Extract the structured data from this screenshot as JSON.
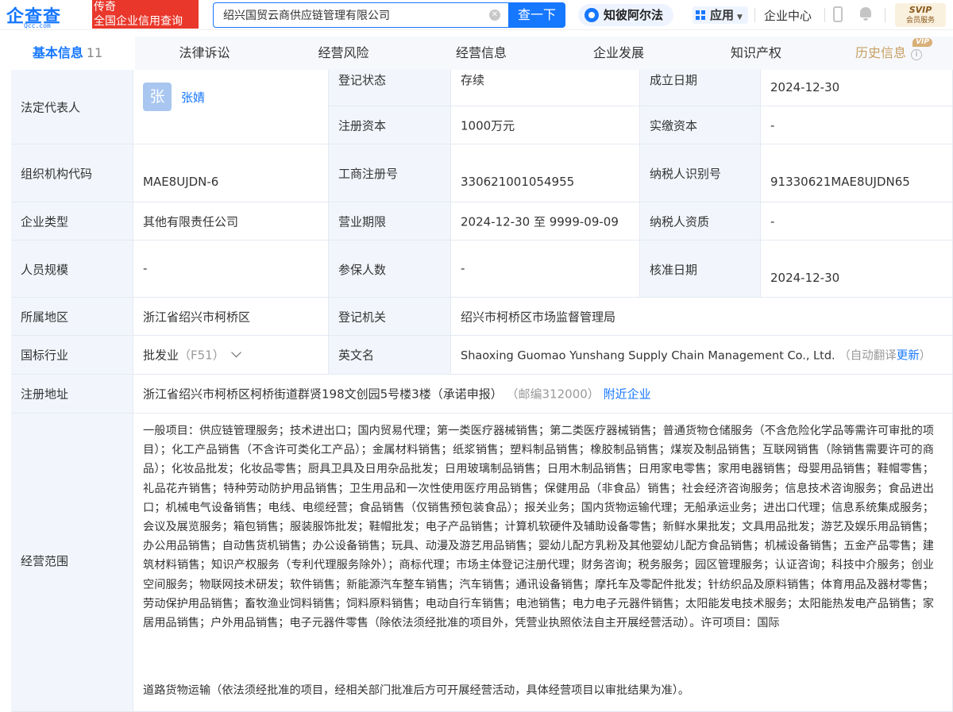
{
  "header": {
    "logo_text": "企查查",
    "logo_domain": "Qcc.com",
    "slogan_line1": "传奇",
    "slogan_line2": "全国企业信用查询",
    "search_value": "绍兴国贸云商供应链管理有限公司",
    "search_button": "查一下",
    "zhibi_label": "知彼阿尔法",
    "apps_label": "应用",
    "enterprise_center": "企业中心",
    "svip_title": "SVIP",
    "svip_sub": "会员服务",
    "accent_color": "#1677ff",
    "slogan_color": "#e9372b"
  },
  "tabs": [
    {
      "label": "基本信息",
      "count": "11"
    },
    {
      "label": "法律诉讼"
    },
    {
      "label": "经营风险"
    },
    {
      "label": "经营信息"
    },
    {
      "label": "企业发展"
    },
    {
      "label": "知识产权"
    },
    {
      "label": "历史信息",
      "badge": "VIP"
    }
  ],
  "info": {
    "legal_rep_label": "法定代表人",
    "legal_rep_avatar": "张",
    "legal_rep_name": "张婧",
    "reg_status_label": "登记状态",
    "reg_status": "存续",
    "est_date_label": "成立日期",
    "est_date": "2024-12-30",
    "reg_capital_label": "注册资本",
    "reg_capital": "1000万元",
    "paid_capital_label": "实缴资本",
    "paid_capital": "-",
    "org_code_label": "组织机构代码",
    "org_code": "MAE8UJDN-6",
    "biz_reg_no_label": "工商注册号",
    "biz_reg_no": "330621001054955",
    "taxpayer_id_label": "纳税人识别号",
    "taxpayer_id": "91330621MAE8UJDN65",
    "ent_type_label": "企业类型",
    "ent_type": "其他有限责任公司",
    "biz_term_label": "营业期限",
    "biz_term": "2024-12-30 至 9999-09-09",
    "taxpayer_qual_label": "纳税人资质",
    "taxpayer_qual": "-",
    "staff_size_label": "人员规模",
    "staff_size": "-",
    "insured_label": "参保人数",
    "insured": "-",
    "approve_date_label": "核准日期",
    "approve_date": "2024-12-30",
    "region_label": "所属地区",
    "region": "浙江省绍兴市柯桥区",
    "reg_authority_label": "登记机关",
    "reg_authority": "绍兴市柯桥区市场监督管理局",
    "industry_label": "国标行业",
    "industry": "批发业",
    "industry_code": "（F51）",
    "english_name_label": "英文名",
    "english_name": "Shaoxing Guomao Yunshang Supply Chain Management Co., Ltd.",
    "auto_translate": "（自动翻译",
    "update_link": "更新",
    "close_paren": "）",
    "address_label": "注册地址",
    "address": "浙江省绍兴市柯桥区柯桥街道群贤198文创园5号楼3楼（承诺申报）",
    "postcode": "（邮编312000）",
    "nearby_link": "附近企业",
    "scope_label": "经营范围",
    "scope_text": "一般项目：供应链管理服务；技术进出口；国内贸易代理；第一类医疗器械销售；第二类医疗器械销售；普通货物仓储服务（不含危险化学品等需许可审批的项目）；化工产品销售（不含许可类化工产品）；金属材料销售；纸浆销售；塑料制品销售；橡胶制品销售；煤炭及制品销售；互联网销售（除销售需要许可的商品）；化妆品批发；化妆品零售；厨具卫具及日用杂品批发；日用玻璃制品销售；日用木制品销售；日用家电零售；家用电器销售；母婴用品销售；鞋帽零售；礼品花卉销售；特种劳动防护用品销售；卫生用品和一次性使用医疗用品销售；保健用品（非食品）销售；社会经济咨询服务；信息技术咨询服务；食品进出口；机械电气设备销售；电线、电缆经营；食品销售（仅销售预包装食品）；报关业务；国内货物运输代理；无船承运业务；进出口代理；信息系统集成服务；会议及展览服务；箱包销售；服装服饰批发；鞋帽批发；电子产品销售；计算机软硬件及辅助设备零售；新鲜水果批发；文具用品批发；游艺及娱乐用品销售；办公用品销售；自动售货机销售；办公设备销售；玩具、动漫及游艺用品销售；婴幼儿配方乳粉及其他婴幼儿配方食品销售；机械设备销售；五金产品零售；建筑材料销售；知识产权服务（专利代理服务除外）；商标代理；市场主体登记注册代理；财务咨询；税务服务；园区管理服务；认证咨询；科技中介服务；创业空间服务；物联网技术研发；软件销售；新能源汽车整车销售；汽车销售；通讯设备销售；摩托车及零配件批发；针纺织品及原料销售；体育用品及器材零售；劳动保护用品销售；畜牧渔业饲料销售；饲料原料销售；电动自行车销售；电池销售；电力电子元器件销售；太阳能发电技术服务；太阳能热发电产品销售；家居用品销售；户外用品销售；电子元器件零售（除依法须经批准的项目外，凭营业执照依法自主开展经营活动）。许可项目：国际",
    "scope_last": "道路货物运输（依法须经批准的项目，经相关部门批准后方可开展经营活动，具体经营项目以审批结果为准）。"
  }
}
